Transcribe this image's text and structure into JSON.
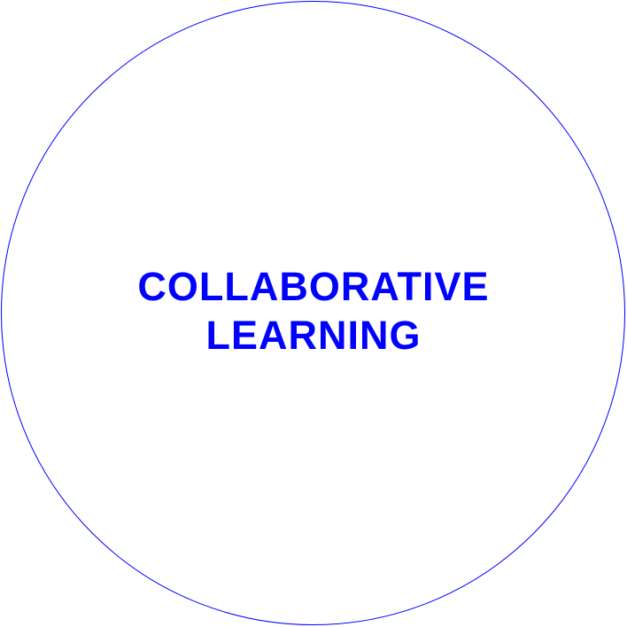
{
  "diagram": {
    "label_lines": [
      "COLLABORATIVE",
      "LEARNING"
    ],
    "colors": {
      "stroke": "#0000ff",
      "text": "#0000ff",
      "background": "#ffffff"
    }
  }
}
